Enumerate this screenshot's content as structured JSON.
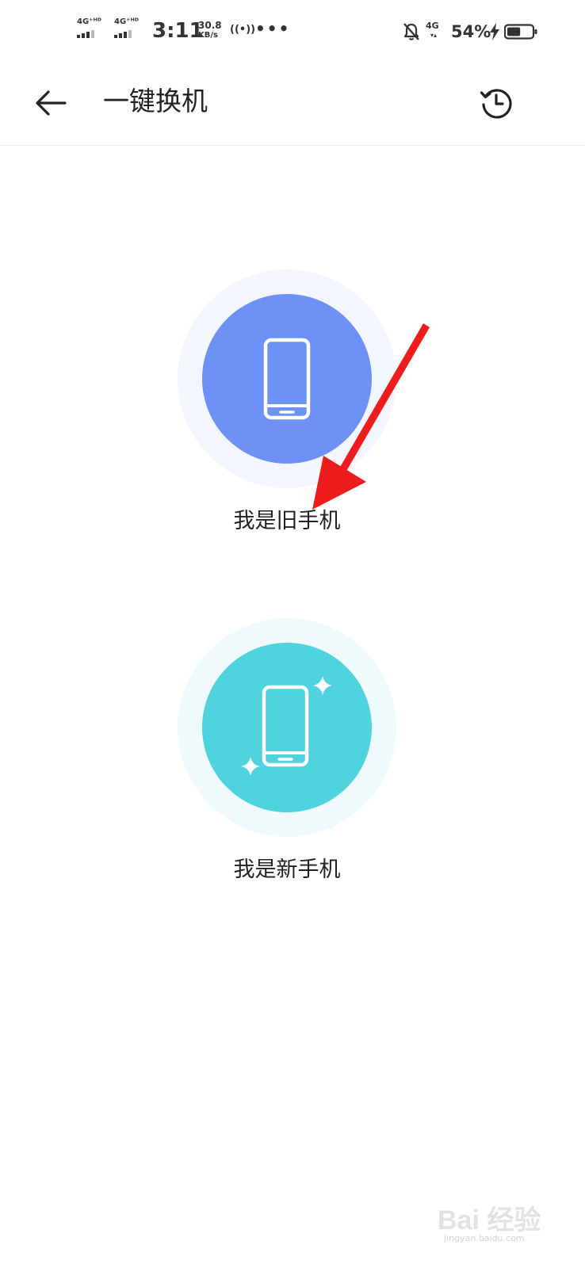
{
  "status_bar": {
    "sim1_label": "4G⁺ᴴᴰ",
    "sim2_label": "4G⁺ᴴᴰ",
    "time": "3:11",
    "speed_value": "30.8",
    "speed_unit": "KB/s",
    "hotspot_glyph": "((•))",
    "more_glyph": "•••",
    "network_type": "4G",
    "battery_percent": "54%",
    "battery_level": 0.54
  },
  "header": {
    "title": "一键换机",
    "back_icon": "arrow-left-icon",
    "history_icon": "history-clock-icon"
  },
  "options": [
    {
      "label": "我是旧手机",
      "icon": "phone-icon",
      "disc_color": "#6e91f6",
      "halo_color": "#f4f6fd"
    },
    {
      "label": "我是新手机",
      "icon": "phone-sparkle-icon",
      "disc_color": "#4fd3df",
      "halo_color": "#effafc"
    }
  ],
  "annotation": {
    "arrow_color": "#ee1c1c"
  },
  "watermark": {
    "brand": "Bai 经验",
    "url": "jingyan.baidu.com"
  }
}
